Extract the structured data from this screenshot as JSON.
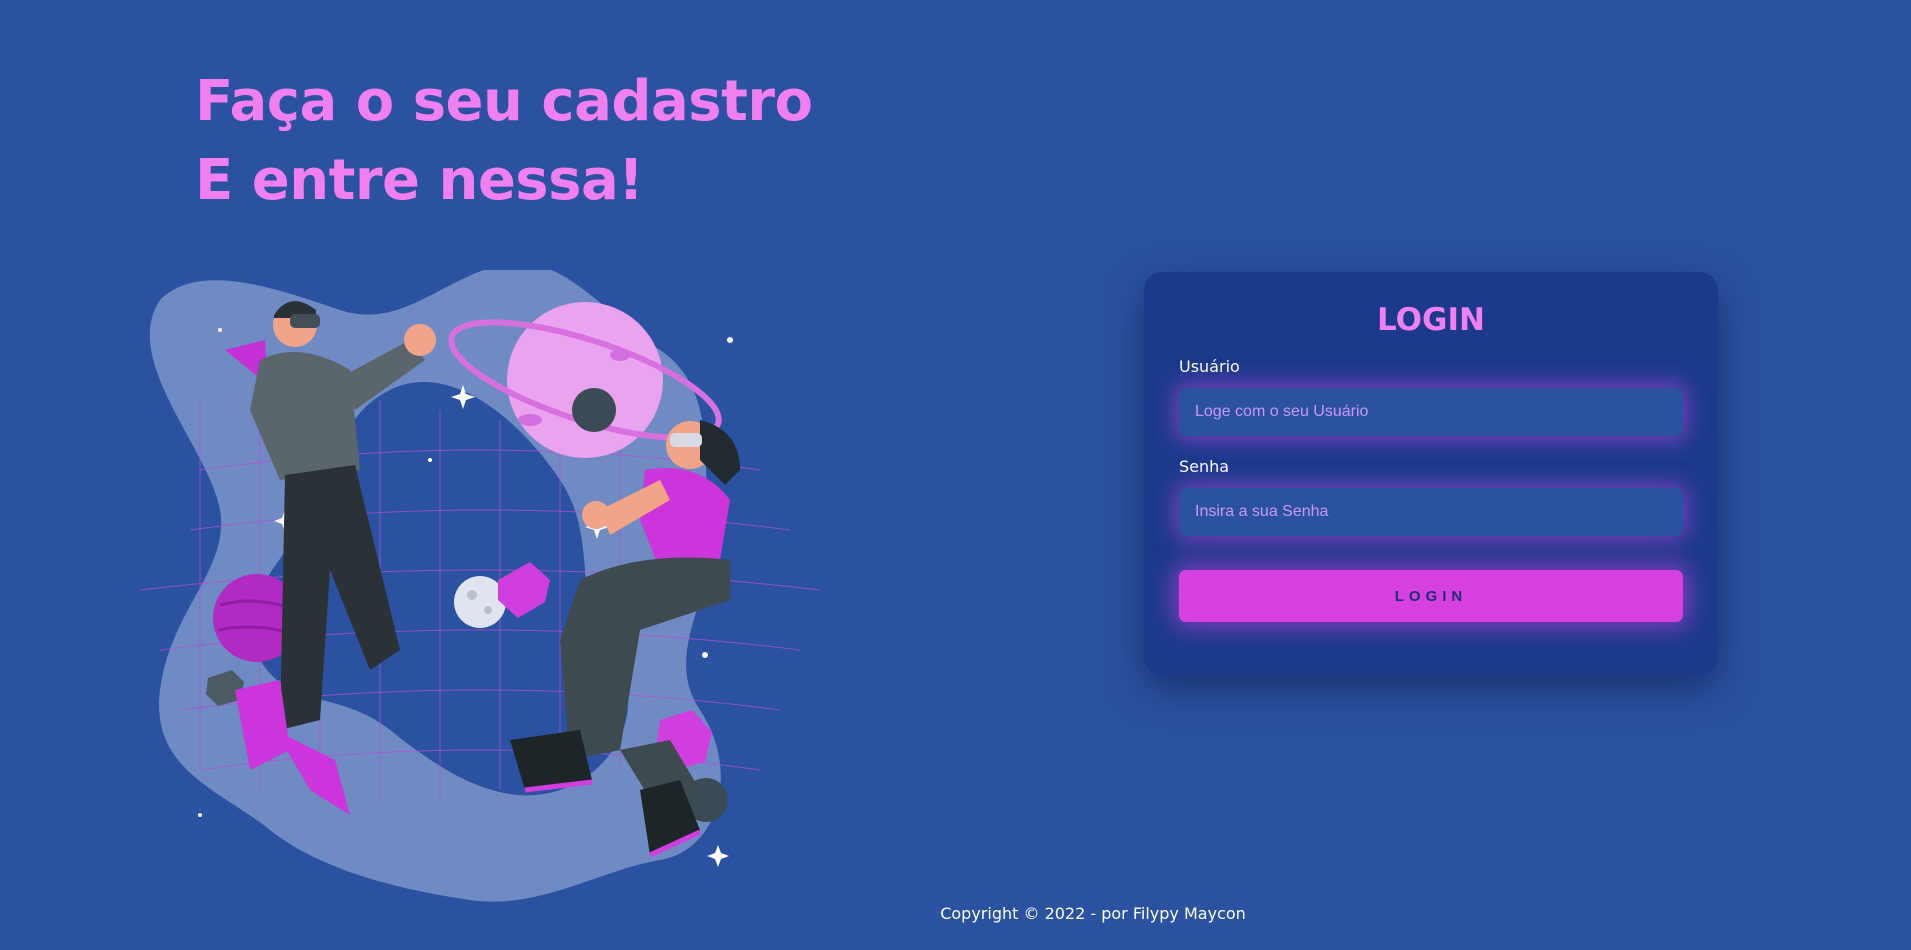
{
  "hero": {
    "line1": "Faça o seu cadastro",
    "line2": "E entre nessa!"
  },
  "login": {
    "title": "LOGIN",
    "username_label": "Usuário",
    "username_placeholder": "Loge com o seu Usuário",
    "password_label": "Senha",
    "password_placeholder": "Insira a sua Senha",
    "button_label": "LOGIN"
  },
  "footer": {
    "copyright": "Copyright © 2022 - por Filypy Maycon"
  },
  "colors": {
    "background": "#2b52a1",
    "card": "#1b3a8c",
    "accent": "#f07ff0",
    "button": "#d640e0"
  }
}
